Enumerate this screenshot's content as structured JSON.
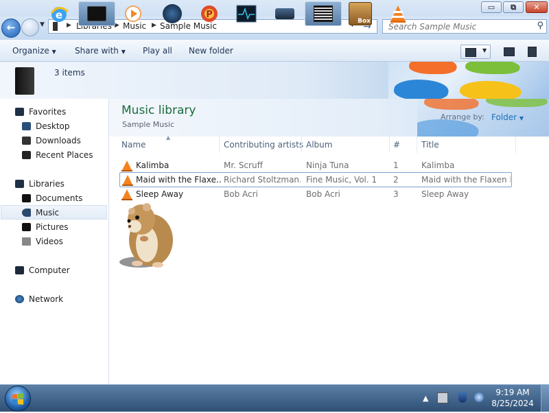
{
  "window": {
    "buttons": {
      "minimize": "▭",
      "maximize": "⧉",
      "close": "✕"
    }
  },
  "address": {
    "breadcrumbs": [
      "Libraries",
      "Music",
      "Sample Music"
    ],
    "search_placeholder": "Search Sample Music"
  },
  "toolbar": {
    "organize": "Organize",
    "share_with": "Share with",
    "play_all": "Play all",
    "new_folder": "New folder"
  },
  "banner": {
    "item_count": "3 items"
  },
  "nav": {
    "favorites": "Favorites",
    "desktop": "Desktop",
    "downloads": "Downloads",
    "recent_places": "Recent Places",
    "libraries": "Libraries",
    "documents": "Documents",
    "music": "Music",
    "pictures": "Pictures",
    "videos": "Videos",
    "computer": "Computer",
    "network": "Network"
  },
  "library": {
    "title": "Music library",
    "subtitle": "Sample Music",
    "arrange_label": "Arrange by:",
    "arrange_value": "Folder"
  },
  "columns": {
    "name": "Name",
    "artists": "Contributing artists",
    "album": "Album",
    "number": "#",
    "title": "Title"
  },
  "files": [
    {
      "name": "Kalimba",
      "artists": "Mr. Scruff",
      "album": "Ninja Tuna",
      "number": "1",
      "title": "Kalimba"
    },
    {
      "name": "Maid with the Flaxe...",
      "artists": "Richard Stoltzman...",
      "album": "Fine Music, Vol. 1",
      "number": "2",
      "title": "Maid with the Flaxen H..."
    },
    {
      "name": "Sleep Away",
      "artists": "Bob Acri",
      "album": "Bob Acri",
      "number": "3",
      "title": "Sleep Away"
    }
  ],
  "taskbar": {
    "box_label": "Box",
    "time": "9:19 AM",
    "date": "8/25/2024"
  },
  "colors": {
    "accent_title": "#1a6b3c",
    "link": "#1d6fb6",
    "vlc_orange": "#f58220"
  }
}
